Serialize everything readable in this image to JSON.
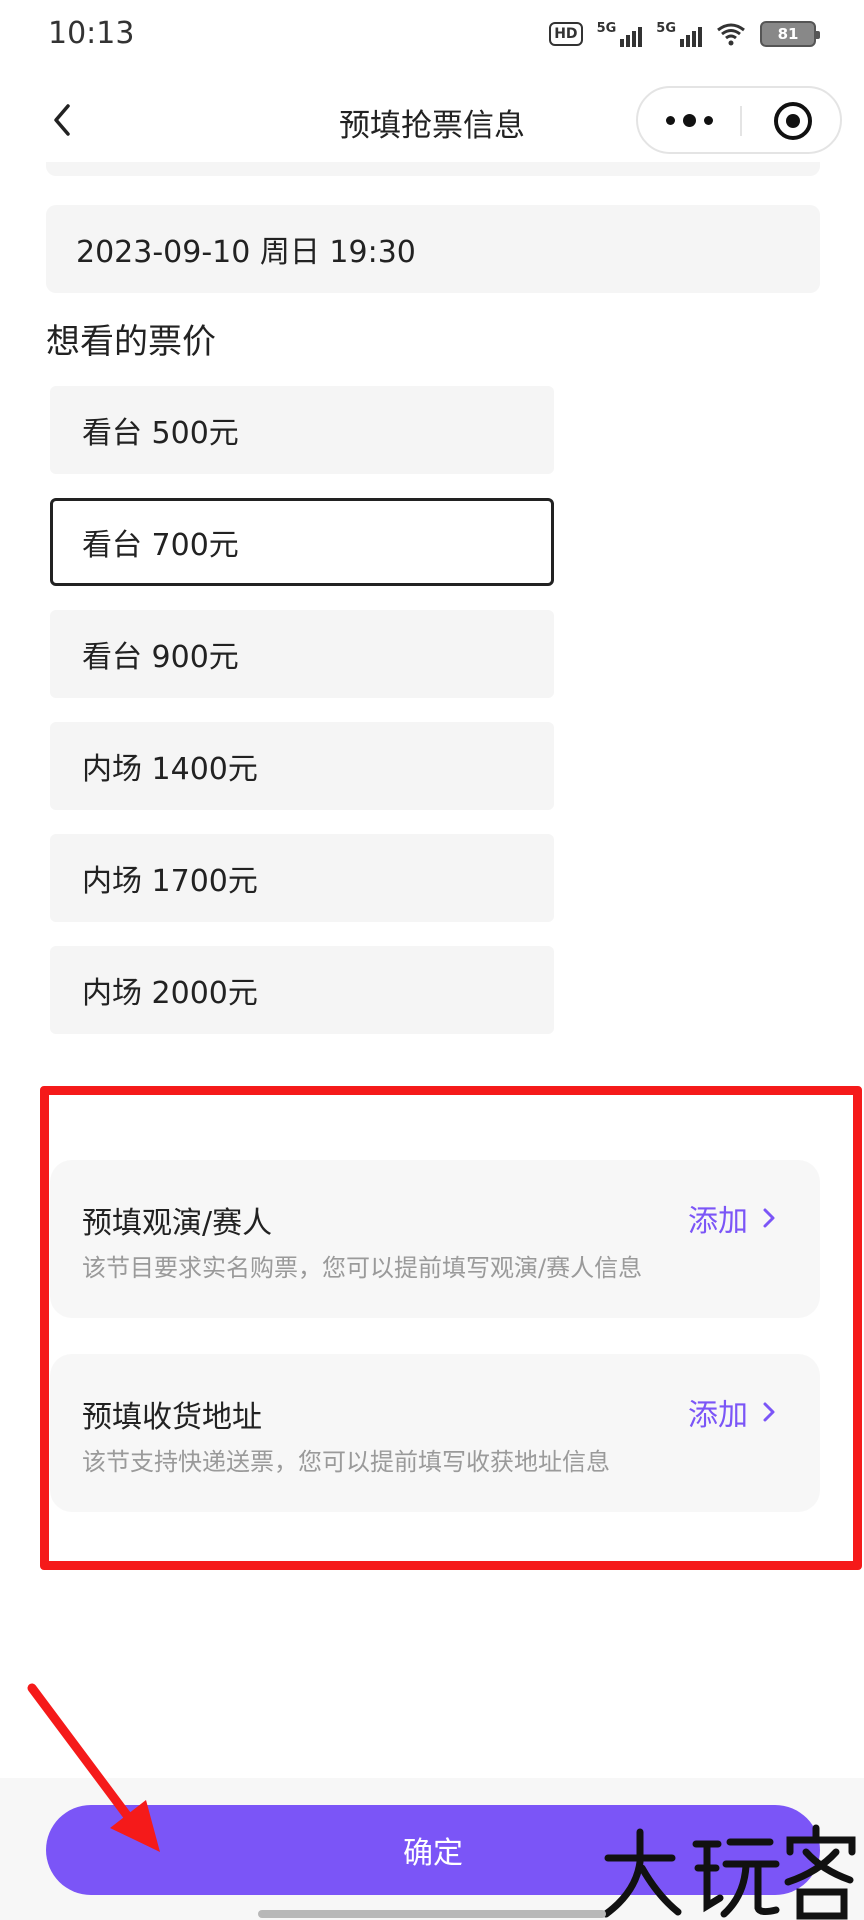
{
  "status_bar": {
    "time": "10:13",
    "hd_label": "HD",
    "net1_label": "5G",
    "net2_label": "5G",
    "battery": "81"
  },
  "nav": {
    "title": "预填抢票信息",
    "back_icon": "chevron-left-icon",
    "more_icon": "more-dots-icon",
    "close_icon": "target-icon"
  },
  "session": {
    "date_value": "2023-09-10 周日 19:30"
  },
  "prices": {
    "title": "想看的票价",
    "options": [
      {
        "label": "看台 500元",
        "selected": false
      },
      {
        "label": "看台 700元",
        "selected": true
      },
      {
        "label": "看台 900元",
        "selected": false
      },
      {
        "label": "内场 1400元",
        "selected": false
      },
      {
        "label": "内场 1700元",
        "selected": false
      },
      {
        "label": "内场 2000元",
        "selected": false
      }
    ]
  },
  "prefill": {
    "audience": {
      "title": "预填观演/赛人",
      "desc": "该节目要求实名购票，您可以提前填写观演/赛人信息",
      "action": "添加"
    },
    "address": {
      "title": "预填收货地址",
      "desc": "该节支持快递送票，您可以提前填写收获地址信息",
      "action": "添加"
    }
  },
  "footer": {
    "confirm_label": "确定",
    "watermark_text": "大玩客"
  },
  "colors": {
    "accent": "#7b55f7",
    "annotation": "#f51a1a",
    "field_bg": "#f5f5f5"
  }
}
